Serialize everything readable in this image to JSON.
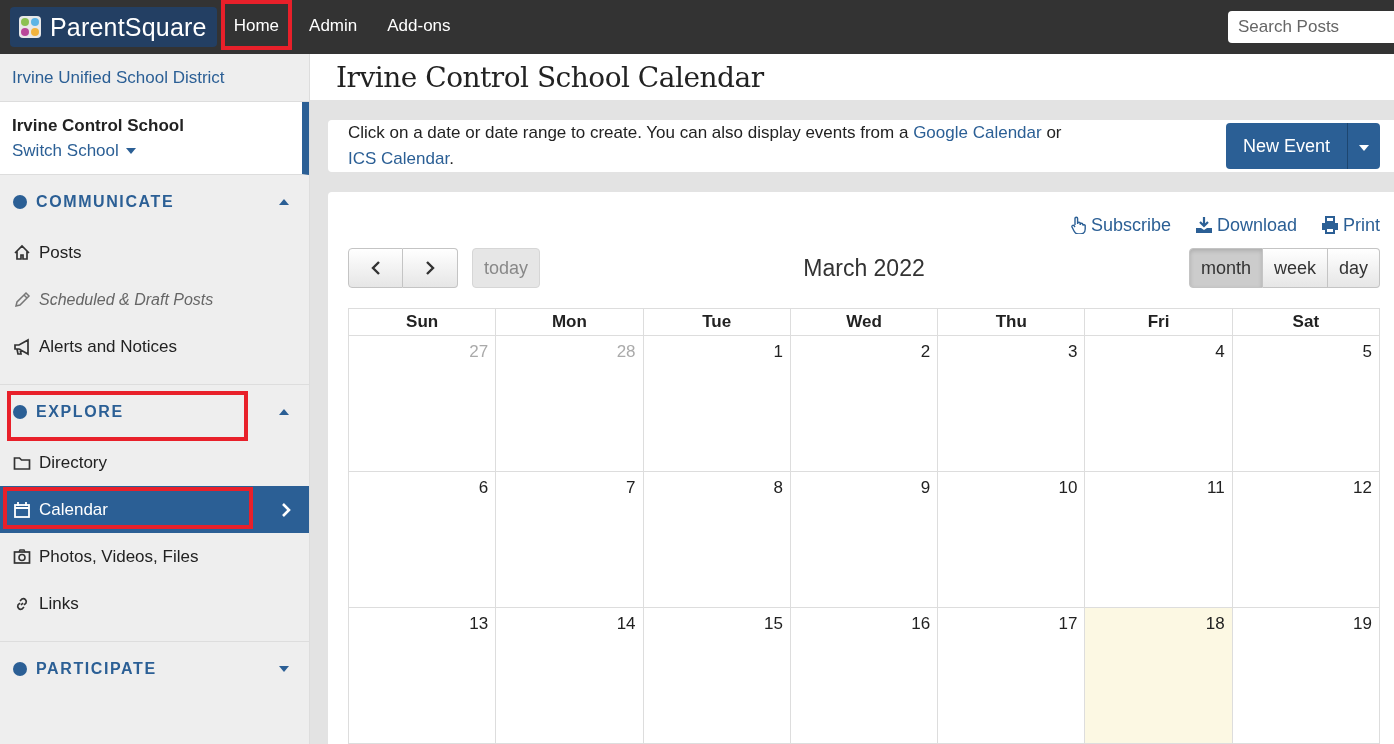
{
  "topbar": {
    "logo": "ParentSquare",
    "nav": [
      {
        "label": "Home",
        "selected": false,
        "annotated": true
      },
      {
        "label": "Admin",
        "selected": false,
        "annotated": false
      },
      {
        "label": "Add-ons",
        "selected": false,
        "annotated": false
      }
    ],
    "search": {
      "placeholder": "Search Posts"
    }
  },
  "sidebar": {
    "district": "Irvine Unified School District",
    "school": {
      "name": "Irvine Control School",
      "switch_label": "Switch School"
    },
    "sections": [
      {
        "title": "COMMUNICATE",
        "expanded": true,
        "annotated": false,
        "items": [
          {
            "label": "Posts",
            "muted": false,
            "selected": false,
            "annotated": false
          },
          {
            "label": "Scheduled & Draft Posts",
            "muted": true,
            "selected": false,
            "annotated": false
          },
          {
            "label": "Alerts and Notices",
            "muted": false,
            "selected": false,
            "annotated": false
          }
        ]
      },
      {
        "title": "EXPLORE",
        "expanded": true,
        "annotated": true,
        "items": [
          {
            "label": "Directory",
            "muted": false,
            "selected": false,
            "annotated": false
          },
          {
            "label": "Calendar",
            "muted": false,
            "selected": true,
            "annotated": true
          },
          {
            "label": "Photos, Videos, Files",
            "muted": false,
            "selected": false,
            "annotated": false
          },
          {
            "label": "Links",
            "muted": false,
            "selected": false,
            "annotated": false
          }
        ]
      },
      {
        "title": "PARTICIPATE",
        "expanded": false,
        "annotated": false
      }
    ]
  },
  "page_title": "Irvine Control School Calendar",
  "info": {
    "text_1": "Click on a date or date range to create. You can also display events from a ",
    "link_1": "Google Calendar",
    "text_2": " or ",
    "link_2": "ICS Calendar",
    "text_3": ".",
    "button": "New Event"
  },
  "calendar": {
    "actions": [
      "Subscribe",
      "Download",
      "Print"
    ],
    "title": "March 2022",
    "today_button": {
      "label": "today",
      "disabled": true
    },
    "views": [
      {
        "label": "month",
        "selected": true
      },
      {
        "label": "week",
        "selected": false
      },
      {
        "label": "day",
        "selected": false
      }
    ],
    "weekdays": [
      "Sun",
      "Mon",
      "Tue",
      "Wed",
      "Thu",
      "Fri",
      "Sat"
    ],
    "weeks": [
      [
        {
          "day": "27",
          "other_month": true,
          "today": false
        },
        {
          "day": "28",
          "other_month": true,
          "today": false
        },
        {
          "day": "1",
          "other_month": false,
          "today": false
        },
        {
          "day": "2",
          "other_month": false,
          "today": false
        },
        {
          "day": "3",
          "other_month": false,
          "today": false
        },
        {
          "day": "4",
          "other_month": false,
          "today": false
        },
        {
          "day": "5",
          "other_month": false,
          "today": false
        }
      ],
      [
        {
          "day": "6",
          "other_month": false,
          "today": false
        },
        {
          "day": "7",
          "other_month": false,
          "today": false
        },
        {
          "day": "8",
          "other_month": false,
          "today": false
        },
        {
          "day": "9",
          "other_month": false,
          "today": false
        },
        {
          "day": "10",
          "other_month": false,
          "today": false
        },
        {
          "day": "11",
          "other_month": false,
          "today": false
        },
        {
          "day": "12",
          "other_month": false,
          "today": false
        }
      ],
      [
        {
          "day": "13",
          "other_month": false,
          "today": false
        },
        {
          "day": "14",
          "other_month": false,
          "today": false
        },
        {
          "day": "15",
          "other_month": false,
          "today": false
        },
        {
          "day": "16",
          "other_month": false,
          "today": false
        },
        {
          "day": "17",
          "other_month": false,
          "today": false
        },
        {
          "day": "18",
          "other_month": false,
          "today": true
        },
        {
          "day": "19",
          "other_month": false,
          "today": false
        }
      ]
    ]
  }
}
